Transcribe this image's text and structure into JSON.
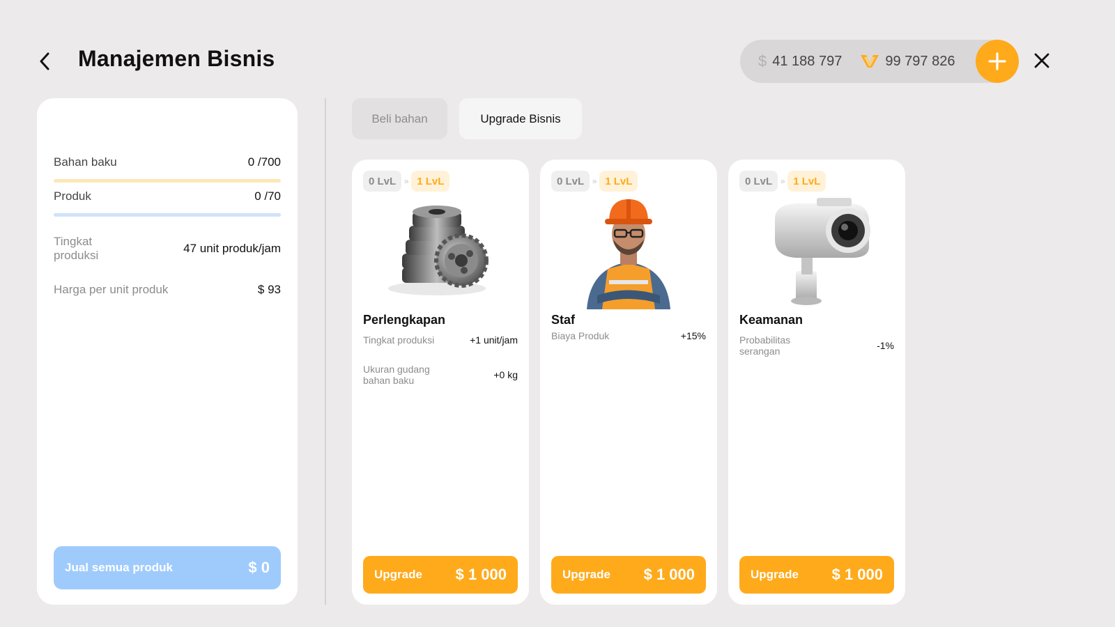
{
  "header": {
    "title": "Manajemen Bisnis",
    "cash": "41 188 797",
    "coins": "99 797 826"
  },
  "colors": {
    "accent": "#FFAA1B",
    "blue": "#9FCBFC",
    "background": "#ECEAEB",
    "bar_material": "#FCE8B6",
    "bar_product": "#CFE2FA"
  },
  "icons": {
    "back": "back-arrow-icon",
    "dollar": "dollar-icon",
    "coin": "coin-icon",
    "add": "plus-icon",
    "close": "close-icon"
  },
  "summary": {
    "raw_material": {
      "label": "Bahan baku",
      "value": "0 /700",
      "current": 0,
      "max": 700
    },
    "product": {
      "label": "Produk",
      "value": "0 /70",
      "current": 0,
      "max": 70
    },
    "production_rate": {
      "label": "Tingkat produksi",
      "value": "47 unit produk/jam"
    },
    "unit_price": {
      "label": "Harga per unit produk",
      "value": "$ 93"
    },
    "sell_all": {
      "label": "Jual semua produk",
      "amount": "$ 0"
    }
  },
  "tabs": [
    {
      "label": "Beli bahan",
      "active": false
    },
    {
      "label": "Upgrade Bisnis",
      "active": true
    }
  ],
  "cards": [
    {
      "title": "Perlengkapan",
      "icon": "gears-icon",
      "level_current": "0 LvL",
      "level_next": "1 LvL",
      "attributes": [
        {
          "label": "Tingkat produksi",
          "value": "+1 unit/jam"
        },
        {
          "label": "Ukuran gudang bahan baku",
          "value": "+0 kg"
        }
      ],
      "button_label": "Upgrade",
      "price": "$ 1 000"
    },
    {
      "title": "Staf",
      "icon": "worker-icon",
      "level_current": "0 LvL",
      "level_next": "1 LvL",
      "attributes": [
        {
          "label": "Biaya Produk",
          "value": "+15%"
        }
      ],
      "button_label": "Upgrade",
      "price": "$ 1 000"
    },
    {
      "title": "Keamanan",
      "icon": "security-camera-icon",
      "level_current": "0 LvL",
      "level_next": "1 LvL",
      "attributes": [
        {
          "label": "Probabilitas serangan",
          "value": "-1%"
        }
      ],
      "button_label": "Upgrade",
      "price": "$ 1 000"
    }
  ]
}
